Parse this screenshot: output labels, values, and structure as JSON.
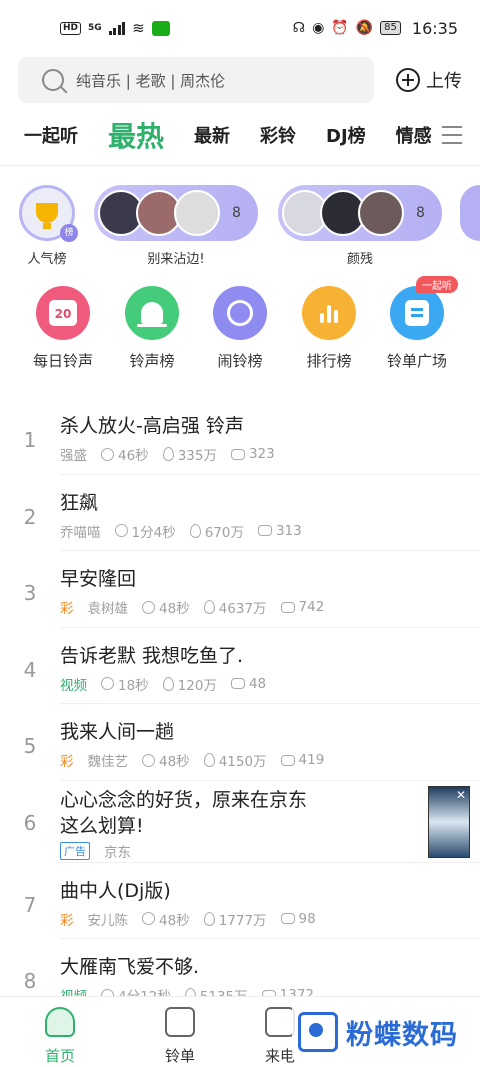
{
  "status_bar": {
    "time": "16:35",
    "battery": "85",
    "hd": "HD",
    "network": "5G"
  },
  "search": {
    "placeholder": "纯音乐 | 老歌 | 周杰伦",
    "upload_label": "上传"
  },
  "tabs": [
    "一起听",
    "最热",
    "最新",
    "彩铃",
    "DJ榜",
    "情感"
  ],
  "active_tab": "最热",
  "groups": [
    {
      "label": "人气榜",
      "badge": "榜"
    },
    {
      "label": "别来沾边!",
      "count": "8"
    },
    {
      "label": "颜残",
      "count": "8"
    }
  ],
  "categories": [
    {
      "label": "每日铃声",
      "icon": "calendar-icon",
      "icon_text": "20",
      "color": "#ef5a7d"
    },
    {
      "label": "铃声榜",
      "icon": "bell-icon",
      "color": "#45cc7a"
    },
    {
      "label": "闹铃榜",
      "icon": "alarm-clock-icon",
      "color": "#8e8cf0"
    },
    {
      "label": "排行榜",
      "icon": "bar-chart-icon",
      "color": "#f7b133"
    },
    {
      "label": "铃单广场",
      "icon": "playlist-icon",
      "color": "#3aa8f2",
      "badge": "一起听"
    }
  ],
  "songs": [
    {
      "rank": "1",
      "title": "杀人放火-高启强 铃声",
      "tag": "",
      "artist": "强盛",
      "duration": "46秒",
      "plays": "335万",
      "comments": "323"
    },
    {
      "rank": "2",
      "title": "狂飙",
      "tag": "",
      "artist": "乔喵喵",
      "duration": "1分4秒",
      "plays": "670万",
      "comments": "313"
    },
    {
      "rank": "3",
      "title": "早安隆回",
      "tag": "彩",
      "artist": "袁树雄",
      "duration": "48秒",
      "plays": "4637万",
      "comments": "742"
    },
    {
      "rank": "4",
      "title": "告诉老默 我想吃鱼了.",
      "tag": "视频",
      "artist": "",
      "duration": "18秒",
      "plays": "120万",
      "comments": "48"
    },
    {
      "rank": "5",
      "title": "我来人间一趟",
      "tag": "彩",
      "artist": "魏佳艺",
      "duration": "48秒",
      "plays": "4150万",
      "comments": "419"
    },
    {
      "rank": "6",
      "title_line1": "心心念念的好货，原来在京东",
      "title_line2": "这么划算!",
      "ad_tag": "广告",
      "advertiser": "京东"
    },
    {
      "rank": "7",
      "title": "曲中人(Dj版)",
      "tag": "彩",
      "artist": "安儿陈",
      "duration": "48秒",
      "plays": "1777万",
      "comments": "98"
    },
    {
      "rank": "8",
      "title": "大雁南飞爱不够.",
      "tag": "视频",
      "artist": "",
      "duration": "4分12秒",
      "plays": "5135万",
      "comments": "1372"
    }
  ],
  "bottom_nav": [
    "首页",
    "铃单",
    "来电"
  ],
  "watermark": "粉蝶数码"
}
